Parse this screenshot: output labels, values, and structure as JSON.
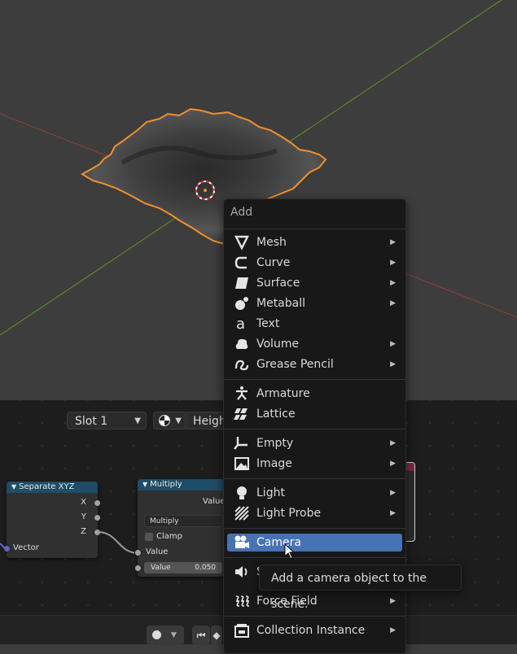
{
  "node_header": {
    "slot_label": "Slot 1",
    "height_field": "Heigh"
  },
  "nodes": {
    "separate_xyz": {
      "title": "Separate XYZ",
      "outputs": [
        "X",
        "Y",
        "Z"
      ],
      "input_label": "Vector"
    },
    "multiply": {
      "title": "Multiply",
      "output_label": "Value",
      "operation": "Multiply",
      "clamp_label": "Clamp",
      "input_label": "Value",
      "value_field_label": "Value",
      "value_field_value": "0.050"
    }
  },
  "add_menu": {
    "title": "Add",
    "items": [
      {
        "label": "Mesh",
        "icon": "mesh-icon",
        "submenu": true
      },
      {
        "label": "Curve",
        "icon": "curve-icon",
        "submenu": true
      },
      {
        "label": "Surface",
        "icon": "surface-icon",
        "submenu": true
      },
      {
        "label": "Metaball",
        "icon": "metaball-icon",
        "submenu": true
      },
      {
        "label": "Text",
        "icon": "text-icon",
        "submenu": false
      },
      {
        "label": "Volume",
        "icon": "volume-icon",
        "submenu": true
      },
      {
        "label": "Grease Pencil",
        "icon": "grease-pencil-icon",
        "submenu": true
      },
      {
        "label": "Armature",
        "icon": "armature-icon",
        "submenu": false
      },
      {
        "label": "Lattice",
        "icon": "lattice-icon",
        "submenu": false
      },
      {
        "label": "Empty",
        "icon": "empty-icon",
        "submenu": true
      },
      {
        "label": "Image",
        "icon": "image-icon",
        "submenu": true
      },
      {
        "label": "Light",
        "icon": "light-icon",
        "submenu": true
      },
      {
        "label": "Light Probe",
        "icon": "light-probe-icon",
        "submenu": true
      },
      {
        "label": "Camera",
        "icon": "camera-icon",
        "submenu": false,
        "highlighted": true
      },
      {
        "label": "S",
        "icon": "speaker-icon",
        "submenu": false
      },
      {
        "label": "Force Field",
        "icon": "force-field-icon",
        "submenu": true
      },
      {
        "label": "Collection Instance",
        "icon": "collection-instance-icon",
        "submenu": true
      }
    ]
  },
  "tooltip": "Add a camera object to the scene.",
  "colors": {
    "highlight": "#4772b3",
    "selection_outline": "#f0902e",
    "x_axis": "#b34a4a",
    "y_axis": "#6a9a2a",
    "node_header": "#1f4c67"
  }
}
